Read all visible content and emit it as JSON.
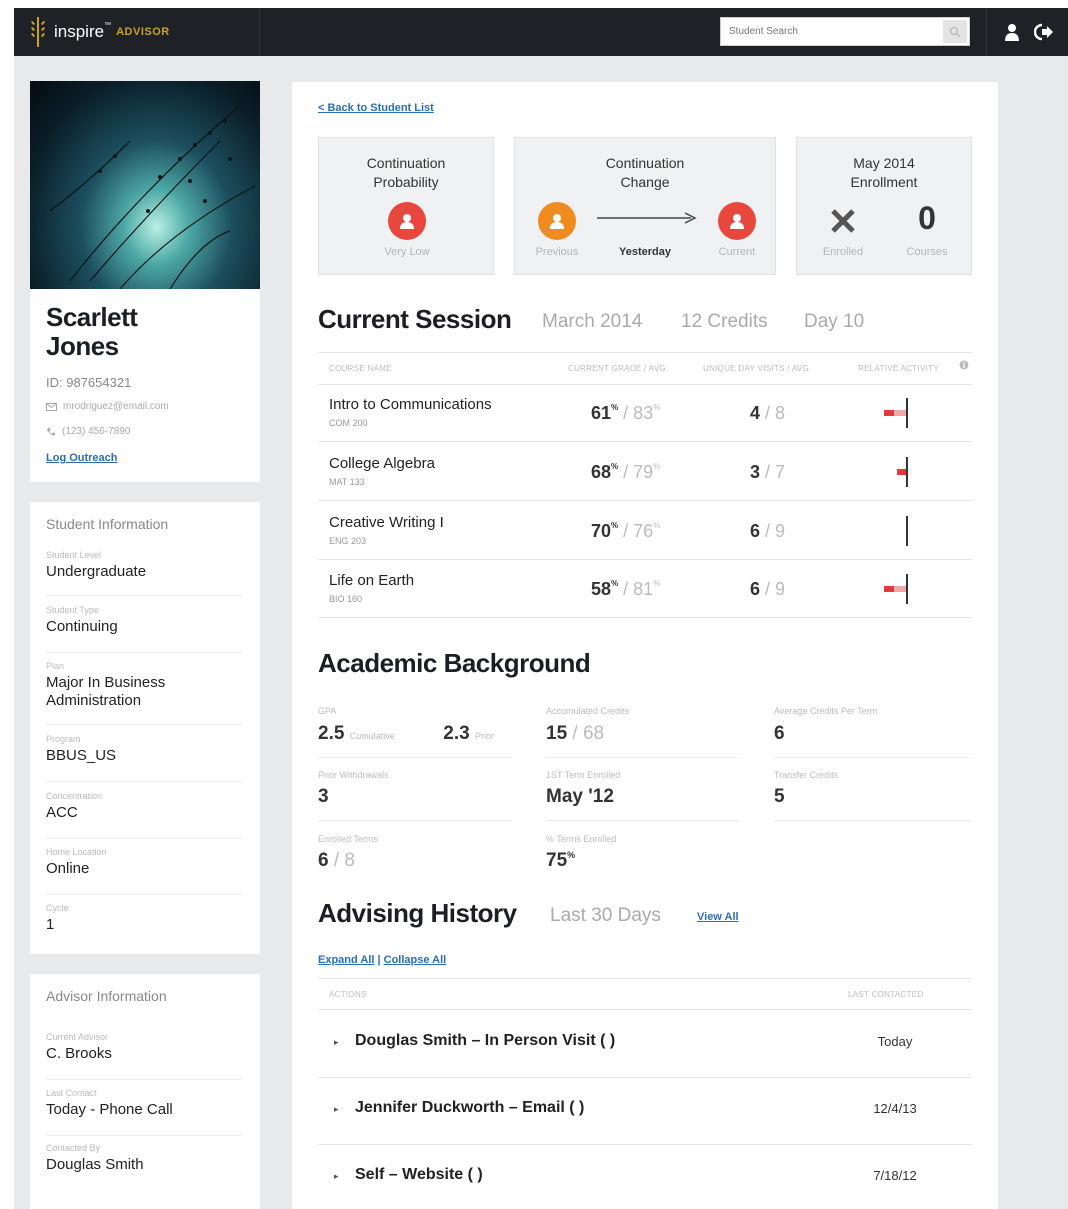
{
  "app": {
    "logo_text": "inspire",
    "logo_tm": "™",
    "logo_sub": "ADVISOR",
    "search_placeholder": "Student Search"
  },
  "student": {
    "first_name": "Scarlett",
    "last_name": "Jones",
    "id_label": "ID: 987654321",
    "email": "mrodriguez@email.com",
    "phone": "(123) 456-7890",
    "log_outreach": "Log Outreach"
  },
  "student_info": {
    "title": "Student Information",
    "fields": [
      {
        "label": "Student Level",
        "value": "Undergraduate"
      },
      {
        "label": "Student Type",
        "value": "Continuing"
      },
      {
        "label": "Plan",
        "value": "Major In Business Administration"
      },
      {
        "label": "Program",
        "value": "BBUS_US"
      },
      {
        "label": "Concentration",
        "value": "ACC"
      },
      {
        "label": "Home Location",
        "value": "Online"
      },
      {
        "label": "Cycle",
        "value": "1"
      }
    ]
  },
  "advisor_info": {
    "title": "Advisor Information",
    "fields": [
      {
        "label": "Current Advisor",
        "value": "C. Brooks"
      },
      {
        "label": "Last Contact",
        "value": "Today - Phone Call"
      },
      {
        "label": "Contacted By",
        "value": "Douglas Smith"
      }
    ]
  },
  "main": {
    "back_link": "< Back to Student List",
    "stats": {
      "probability": {
        "title": "Continuation Probability",
        "label": "Very Low"
      },
      "change": {
        "title": "Continuation Change",
        "previous": "Previous",
        "yesterday": "Yesterday",
        "current": "Current"
      },
      "enrollment": {
        "title": "May 2014 Enrollment",
        "enrolled": "Enrolled",
        "courses_count": "0",
        "courses": "Courses"
      }
    },
    "session": {
      "title": "Current Session",
      "term": "March 2014",
      "credits": "12 Credits",
      "day": "Day 10",
      "headers": {
        "course": "Course Name",
        "grade": "Current Grade / Avg.",
        "visits": "Unique Day Visits / Avg.",
        "activity": "Relative Activity"
      },
      "courses": [
        {
          "name": "Intro to Communications",
          "code": "COM 200",
          "grade": "61",
          "grade_avg": "/ 83",
          "visits": "4",
          "visits_avg": "/ 8",
          "activity": 2
        },
        {
          "name": "College Algebra",
          "code": "MAT 133",
          "grade": "68",
          "grade_avg": "/ 79",
          "visits": "3",
          "visits_avg": "/ 7",
          "activity": 1
        },
        {
          "name": "Creative Writing I",
          "code": "ENG 203",
          "grade": "70",
          "grade_avg": "/ 76",
          "visits": "6",
          "visits_avg": "/ 9",
          "activity": 0
        },
        {
          "name": "Life on Earth",
          "code": "BIO 160",
          "grade": "58",
          "grade_avg": "/ 81",
          "visits": "6",
          "visits_avg": "/ 9",
          "activity": 2
        }
      ],
      "pct": "%"
    },
    "academic": {
      "title": "Academic Background",
      "gpa_label": "GPA",
      "gpa_cumulative": "2.5",
      "gpa_cumulative_lbl": "Cumulative",
      "gpa_prior": "2.3",
      "gpa_prior_lbl": "Prior",
      "accum_label": "Accumulated Credits",
      "accum": "15",
      "accum_total": "/ 68",
      "avg_label": "Average Credits Per Term",
      "avg": "6",
      "withdrawals_label": "Prior Withdrawals",
      "withdrawals": "3",
      "first_term_label": "1ST Term Enrolled",
      "first_term": "May '12",
      "transfer_label": "Transfer Credits",
      "transfer": "5",
      "enrolled_terms_label": "Enrolled Terms",
      "enrolled_terms": "6",
      "enrolled_terms_total": "/ 8",
      "pct_terms_label": "% Terms Enrolled",
      "pct_terms": "75"
    },
    "history": {
      "title": "Advising History",
      "range": "Last 30 Days",
      "view_all": "View All",
      "expand_all": "Expand All",
      "sep": "|",
      "collapse_all": "Collapse All",
      "headers": {
        "actions": "Actions",
        "last": "Last Contacted"
      },
      "entries": [
        {
          "text": "Douglas Smith – In Person Visit ( )",
          "date": "Today"
        },
        {
          "text": "Jennifer Duckworth – Email ( )",
          "date": "12/4/13"
        },
        {
          "text": "Self – Website ( )",
          "date": "7/18/12"
        }
      ]
    }
  },
  "colors": {
    "accent": "#2a6fb6",
    "danger": "#e8473e",
    "warning": "#f08b1f",
    "topbar": "#1e2226",
    "logo": "#c9a227"
  }
}
